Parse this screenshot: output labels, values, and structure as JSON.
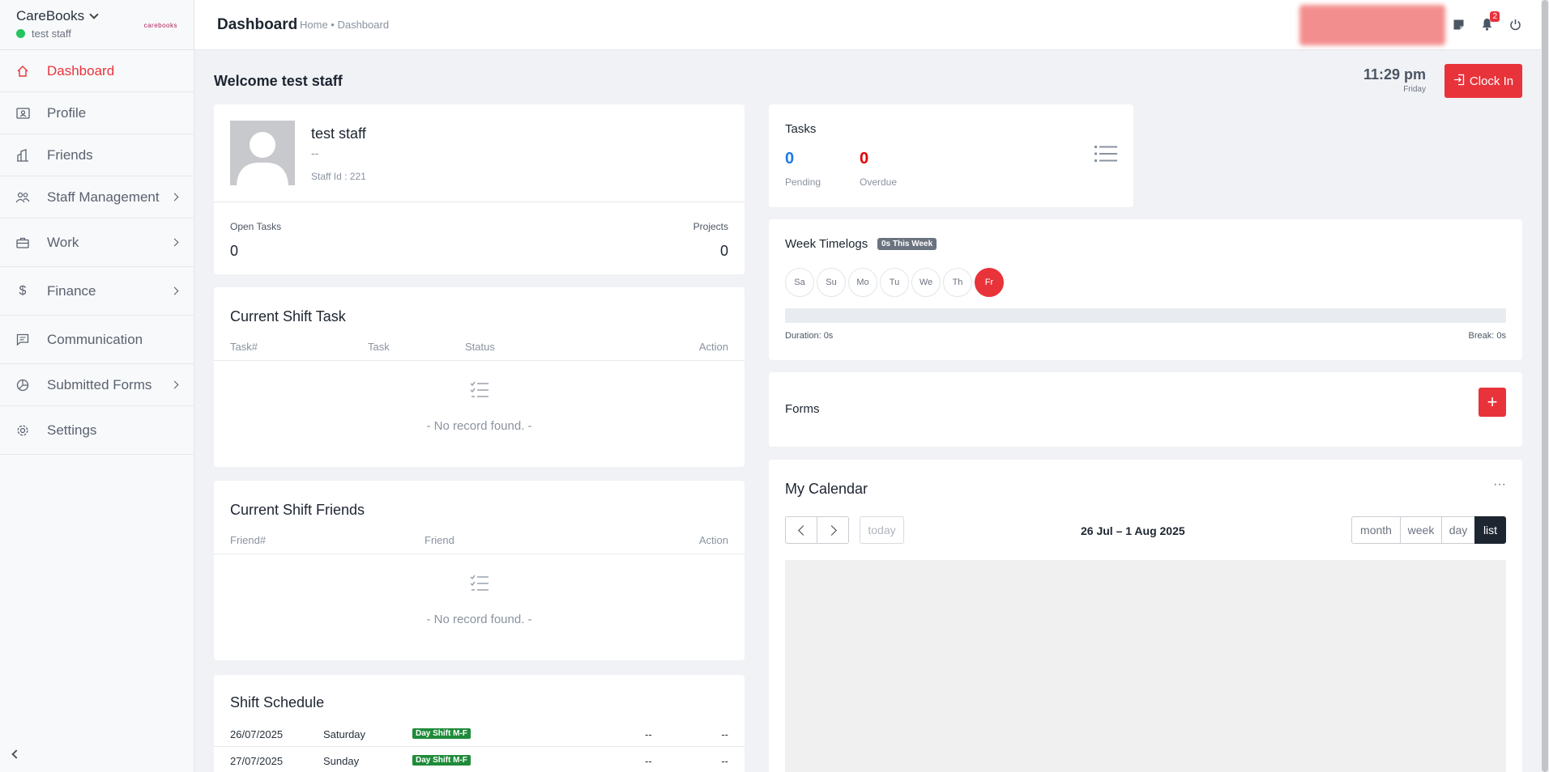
{
  "sidebar": {
    "brand": "CareBooks",
    "user_status": "test staff",
    "logo_text": "carebooks",
    "items": [
      {
        "label": "Dashboard"
      },
      {
        "label": "Profile"
      },
      {
        "label": "Friends"
      },
      {
        "label": "Staff Management"
      },
      {
        "label": "Work"
      },
      {
        "label": "Finance"
      },
      {
        "label": "Communication"
      },
      {
        "label": "Submitted Forms"
      },
      {
        "label": "Settings"
      }
    ]
  },
  "header": {
    "title": "Dashboard",
    "breadcrumb": "Home • Dashboard",
    "notification_count": "2"
  },
  "welcome": "Welcome test staff",
  "clock": {
    "time": "11:29 pm",
    "day": "Friday",
    "button": "Clock In"
  },
  "profile": {
    "name": "test staff",
    "subtitle": "--",
    "staff_id": "Staff Id : 221",
    "open_tasks_label": "Open Tasks",
    "open_tasks_value": "0",
    "projects_label": "Projects",
    "projects_value": "0"
  },
  "current_shift_task": {
    "title": "Current Shift Task",
    "columns": [
      "Task#",
      "Task",
      "Status",
      "Action"
    ],
    "empty": "- No record found. -"
  },
  "current_shift_friends": {
    "title": "Current Shift Friends",
    "columns": [
      "Friend#",
      "Friend",
      "Action"
    ],
    "empty": "- No record found. -"
  },
  "shift_schedule": {
    "title": "Shift Schedule",
    "rows": [
      {
        "date": "26/07/2025",
        "day": "Saturday",
        "shift": "Day Shift M-F",
        "c1": "--",
        "c2": "--"
      },
      {
        "date": "27/07/2025",
        "day": "Sunday",
        "shift": "Day Shift M-F",
        "c1": "--",
        "c2": "--"
      }
    ]
  },
  "tasks": {
    "title": "Tasks",
    "pending_value": "0",
    "pending_label": "Pending",
    "overdue_value": "0",
    "overdue_label": "Overdue"
  },
  "week_timelogs": {
    "title": "Week Timelogs",
    "badge": "0s This Week",
    "days": [
      "Sa",
      "Su",
      "Mo",
      "Tu",
      "We",
      "Th",
      "Fr"
    ],
    "today_index": 6,
    "progress": 0,
    "duration": "Duration: 0s",
    "break": "Break: 0s"
  },
  "forms": {
    "title": "Forms",
    "add": "+"
  },
  "calendar": {
    "title": "My Calendar",
    "more": "···",
    "today": "today",
    "range": "26 Jul – 1 Aug 2025",
    "views": [
      "month",
      "week",
      "day",
      "list"
    ],
    "active_view": "list"
  },
  "colors": {
    "accent": "#e8333b",
    "blue": "#1e7be6",
    "green": "#1f8b3a"
  }
}
